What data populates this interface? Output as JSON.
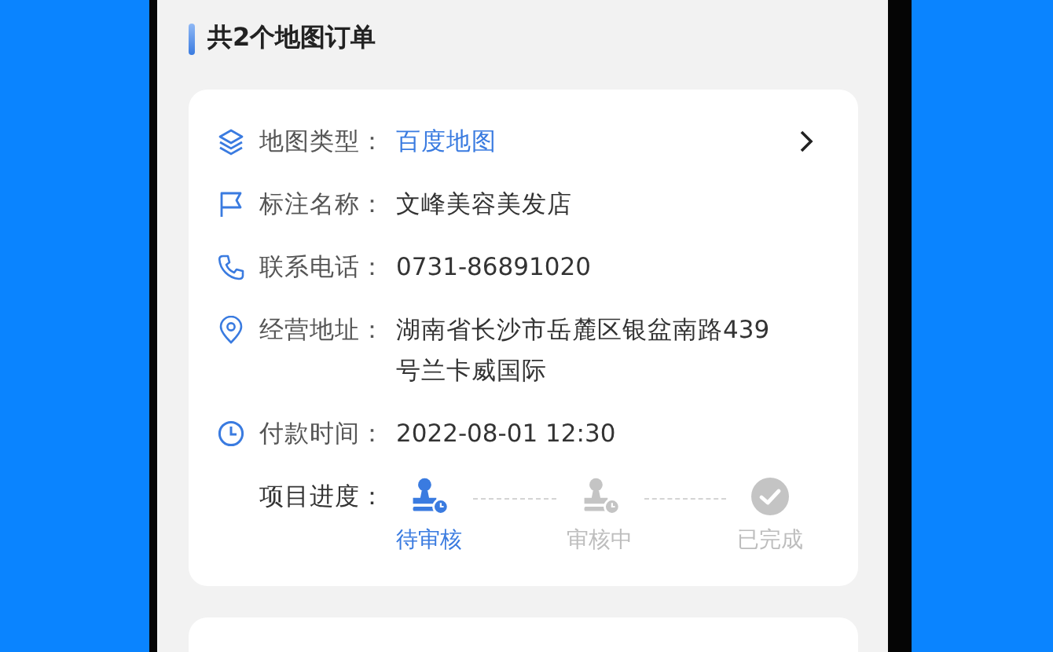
{
  "header": {
    "title": "共2个地图订单"
  },
  "order": {
    "fields": [
      {
        "kind": "map_type",
        "label": "地图类型：",
        "value": "百度地图"
      },
      {
        "kind": "name",
        "label": "标注名称：",
        "value": "文峰美容美发店"
      },
      {
        "kind": "phone",
        "label": "联系电话：",
        "value": "0731-86891020"
      },
      {
        "kind": "address",
        "label": "经营地址：",
        "value": "湖南省长沙市岳麓区银盆南路439号兰卡威国际"
      },
      {
        "kind": "time",
        "label": "付款时间：",
        "value": "2022-08-01 12:30"
      }
    ],
    "progress": {
      "label": "项目进度：",
      "steps": [
        {
          "label": "待审核",
          "kind": "stamp",
          "selected": true
        },
        {
          "label": "审核中",
          "kind": "stamp",
          "selected": false
        },
        {
          "label": "已完成",
          "kind": "check",
          "selected": false
        }
      ]
    }
  }
}
